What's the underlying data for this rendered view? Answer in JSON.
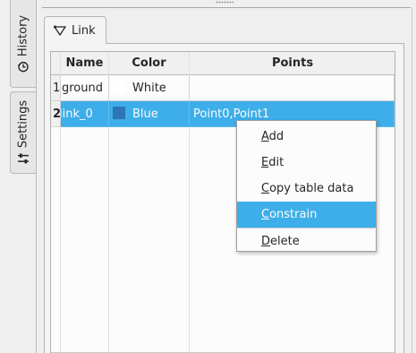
{
  "side_tabs": [
    {
      "label": "History",
      "icon": "history-icon"
    },
    {
      "label": "Settings",
      "icon": "sliders-icon"
    }
  ],
  "tab": {
    "label": "Link",
    "icon": "link-tool-icon"
  },
  "table": {
    "columns": [
      "Name",
      "Color",
      "Points"
    ],
    "rows": [
      {
        "index": "1",
        "name": "ground",
        "color": "White",
        "swatch": "#ffffff",
        "points": ""
      },
      {
        "index": "2",
        "name": "link_0",
        "color": "Blue",
        "swatch": "#2f74b5",
        "points": "Point0,Point1"
      }
    ],
    "selected_row": 1
  },
  "context_menu": {
    "items": [
      {
        "first": "A",
        "rest": "dd"
      },
      {
        "first": "E",
        "rest": "dit"
      },
      {
        "first": "C",
        "rest": "opy table data"
      },
      {
        "first": "C",
        "rest": "onstrain"
      },
      {
        "first": "D",
        "rest": "elete"
      }
    ],
    "highlighted": "Constrain"
  },
  "colors": {
    "accent": "#3daee9",
    "background": "#efefef",
    "table_bg": "#fcfcfc"
  }
}
